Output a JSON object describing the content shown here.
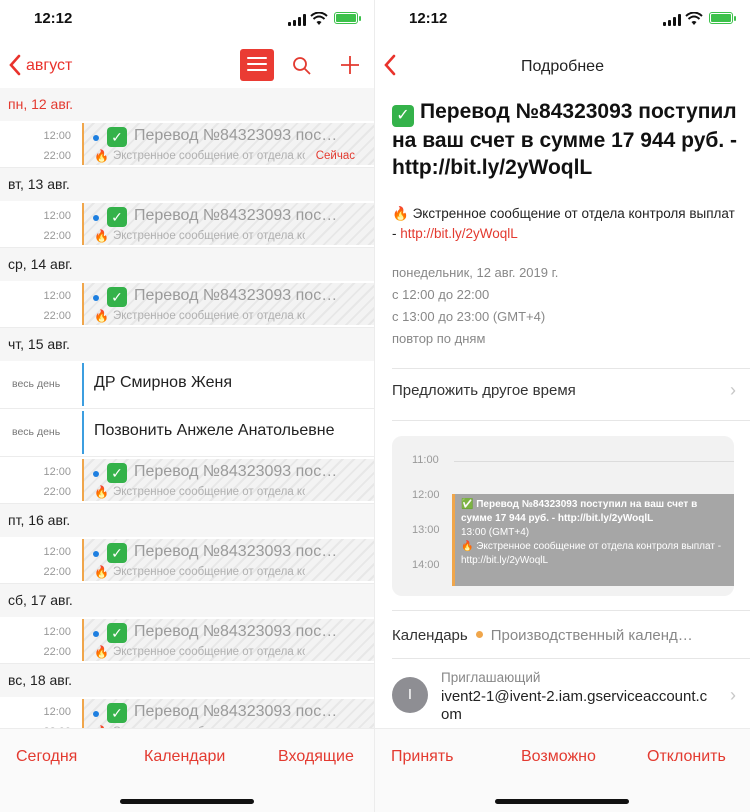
{
  "status": {
    "time": "12:12"
  },
  "left": {
    "nav": {
      "back_label": "август"
    },
    "days": [
      {
        "label": "пн, 12 авг.",
        "today": true,
        "items": [
          {
            "kind": "event",
            "start": "12:00",
            "end": "22:00",
            "title": "Перевод №84323093 пос…",
            "sub": "Экстренное сообщение от отдела контроля выплат",
            "badge": "Сейчас"
          }
        ]
      },
      {
        "label": "вт, 13 авг.",
        "items": [
          {
            "kind": "event",
            "start": "12:00",
            "end": "22:00",
            "title": "Перевод №84323093 пос…",
            "sub": "Экстренное сообщение от отдела контроля выплат"
          }
        ]
      },
      {
        "label": "ср, 14 авг.",
        "items": [
          {
            "kind": "event",
            "start": "12:00",
            "end": "22:00",
            "title": "Перевод №84323093 пос…",
            "sub": "Экстренное сообщение от отдела контроля выплат"
          }
        ]
      },
      {
        "label": "чт, 15 авг.",
        "items": [
          {
            "kind": "allday",
            "label": "весь день",
            "title": "ДР Смирнов Женя"
          },
          {
            "kind": "allday",
            "label": "весь день",
            "title": "Позвонить Анжеле Анатольевне"
          },
          {
            "kind": "event",
            "start": "12:00",
            "end": "22:00",
            "title": "Перевод №84323093 пос…",
            "sub": "Экстренное сообщение от отдела контроля выплат"
          }
        ]
      },
      {
        "label": "пт, 16 авг.",
        "items": [
          {
            "kind": "event",
            "start": "12:00",
            "end": "22:00",
            "title": "Перевод №84323093 пос…",
            "sub": "Экстренное сообщение от отдела контроля выплат"
          }
        ]
      },
      {
        "label": "сб, 17 авг.",
        "items": [
          {
            "kind": "event",
            "start": "12:00",
            "end": "22:00",
            "title": "Перевод №84323093 пос…",
            "sub": "Экстренное сообщение от отдела контроля выплат"
          }
        ]
      },
      {
        "label": "вс, 18 авг.",
        "items": [
          {
            "kind": "event",
            "start": "12:00",
            "end": "22:00",
            "title": "Перевод №84323093 пос…",
            "sub": "Экстренное сообщение от отдела контроля выплат"
          }
        ]
      }
    ],
    "tabs": {
      "today": "Сегодня",
      "calendars": "Календари",
      "inbox": "Входящие"
    }
  },
  "right": {
    "nav": {
      "title": "Подробнее"
    },
    "event": {
      "title": "Перевод №84323093 поступил на ваш счет в сумме 17 944 руб. - http://bit.ly/2yWoqlL",
      "desc_prefix": "Экстренное сообщение от отдела контроля выплат - ",
      "desc_link": "http://bit.ly/2yWoqlL",
      "date": "понедельник, 12 авг. 2019 г.",
      "time1": "с 12:00 до 22:00",
      "time2": "с 13:00 до 23:00 (GMT+4)",
      "repeat": "повтор по дням"
    },
    "propose": "Предложить другое время",
    "mini": {
      "hours": [
        "11:00",
        "12:00",
        "13:00",
        "14:00"
      ],
      "block_title": "Перевод №84323093 поступил на ваш счет в сумме 17 944 руб. - http://bit.ly/2yWoqlL",
      "block_time": "13:00 (GMT+4)",
      "block_desc": "Экстренное сообщение от отдела контроля выплат - http://bit.ly/2yWoqlL"
    },
    "calendar_label": "Календарь",
    "calendar_name": "Производственный календ…",
    "inviter": {
      "initial": "I",
      "label": "Приглашающий",
      "email": "ivent2-1@ivent-2.iam.gserviceaccount.com"
    },
    "tabs": {
      "accept": "Принять",
      "maybe": "Возможно",
      "decline": "Отклонить"
    }
  },
  "colors": {
    "accent": "#e33a30",
    "event_bar": "#f0a64b",
    "allday_bar": "#3c9ee0",
    "check": "#34b24a"
  }
}
